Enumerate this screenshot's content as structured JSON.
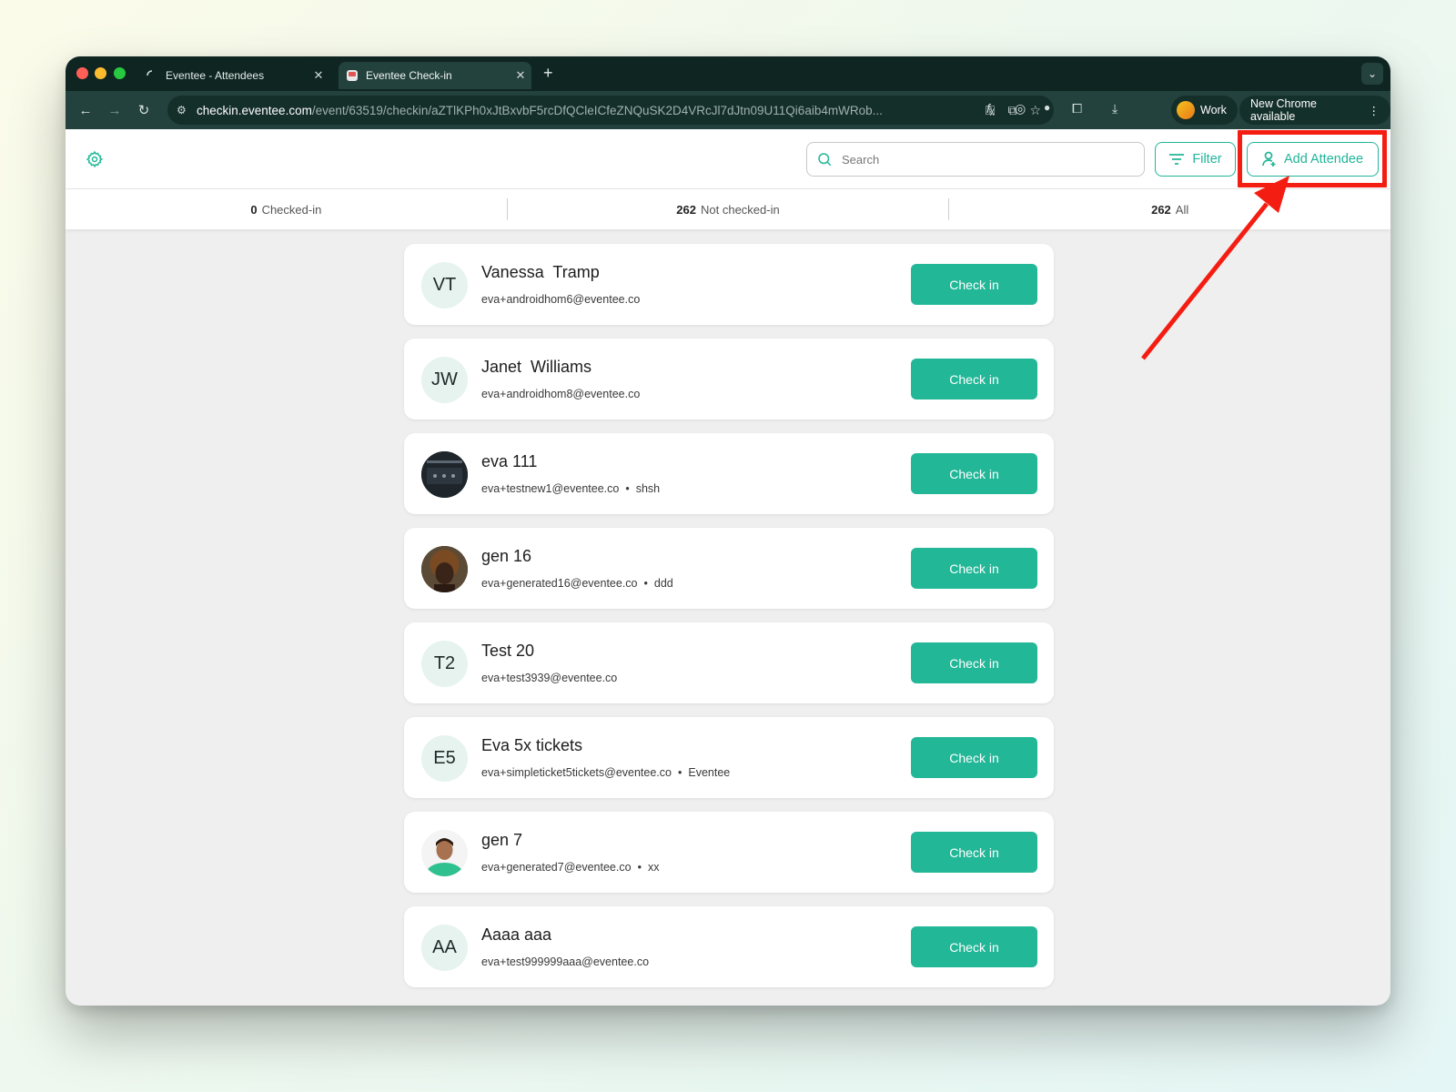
{
  "browser": {
    "tabs": [
      {
        "title": "Eventee - Attendees",
        "active": false
      },
      {
        "title": "Eventee Check-in",
        "active": true
      }
    ],
    "url_host": "checkin.eventee.com",
    "url_path": "/event/63519/checkin/aZTlKPh0xJtBxvbF5rcDfQCleICfeZNQuSK2D4VRcJl7dJtn09U11Qi6aib4mWRob...",
    "profile_label": "Work",
    "update_label": "New Chrome available",
    "colors": {
      "frame": "#0f2522",
      "toolbar": "#24423d"
    }
  },
  "header": {
    "search_placeholder": "Search",
    "filter_label": "Filter",
    "add_attendee_label": "Add Attendee"
  },
  "stats": {
    "checked_in_count": "0",
    "checked_in_label": "Checked-in",
    "not_checked_in_count": "262",
    "not_checked_in_label": "Not checked-in",
    "all_count": "262",
    "all_label": "All"
  },
  "attendees": [
    {
      "initials": "VT",
      "name": "Vanessa  Tramp",
      "email": "eva+androidhom6@eventee.co",
      "extra": "",
      "button": "Check in"
    },
    {
      "initials": "JW",
      "name": "Janet  Williams",
      "email": "eva+androidhom8@eventee.co",
      "extra": "",
      "button": "Check in"
    },
    {
      "initials": "",
      "name": "eva 111",
      "email": "eva+testnew1@eventee.co",
      "extra": "shsh",
      "button": "Check in"
    },
    {
      "initials": "",
      "name": "gen 16",
      "email": "eva+generated16@eventee.co",
      "extra": "ddd",
      "button": "Check in"
    },
    {
      "initials": "T2",
      "name": "Test 20",
      "email": "eva+test3939@eventee.co",
      "extra": "",
      "button": "Check in"
    },
    {
      "initials": "E5",
      "name": "Eva 5x tickets",
      "email": "eva+simpleticket5tickets@eventee.co",
      "extra": "Eventee",
      "button": "Check in"
    },
    {
      "initials": "",
      "name": "gen 7",
      "email": "eva+generated7@eventee.co",
      "extra": "xx",
      "button": "Check in"
    },
    {
      "initials": "AA",
      "name": "Aaaa aaa",
      "email": "eva+test999999aaa@eventee.co",
      "extra": "",
      "button": "Check in"
    }
  ],
  "bullet": "•",
  "colors": {
    "accent": "#22b797",
    "highlight": "#f41d12",
    "avatar_bg": "#e6f3ef"
  },
  "icons": [
    "gear-icon",
    "search-icon",
    "filter-icon",
    "add-person-icon",
    "arrow-annotation"
  ]
}
